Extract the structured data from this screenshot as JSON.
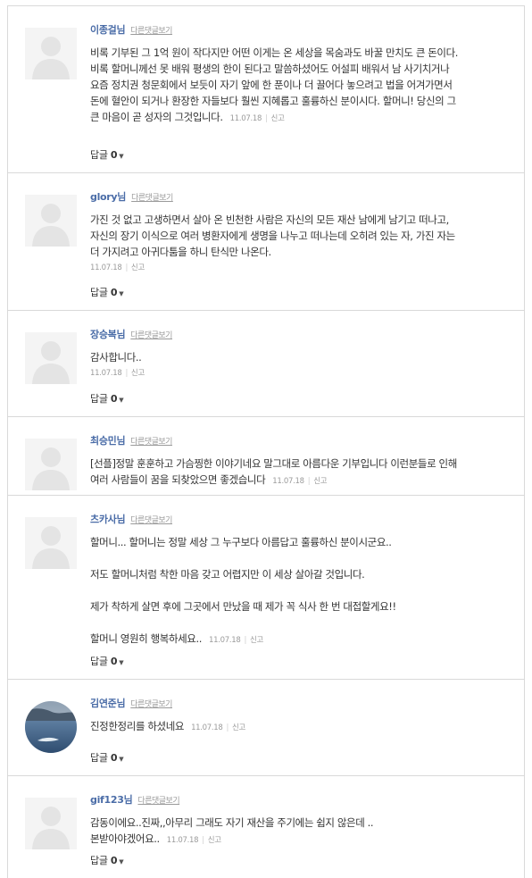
{
  "other_replies_label": "다른댓글보기",
  "report_label": "신고",
  "reply_label": "답글",
  "comments": [
    {
      "author": "이종걸님",
      "paragraphs": [
        "비록 기부된 그 1억 원이 작다지만 어떤 이게는 온 세상을 목숨과도 바꿀 만치도 큰 돈이다. 비록 할머니께선 못 배워 평생의 한이 된다고 말씀하셨어도 어설피 배워서 남 사기치거나 요즘 정치권 청문회에서 보듯이 자기 앞에 한 푼이나 더 끌어다 놓으려고 법을 어겨가면서 돈에 혈안이 되거나 환장한 자들보다 훨씬 지혜롭고 훌륭하신 분이시다. 할머니! 당신의 그 큰 마음이 곧 성자의 그것입니다."
      ],
      "date": "11.07.18",
      "replies": "0"
    },
    {
      "author": "glory님",
      "paragraphs": [
        "가진 것 없고 고생하면서 살아 온 빈천한 사람은 자신의 모든 재산 남에게 남기고 떠나고, 자신의 장기 이식으로 여러 병환자에게 생명을 나누고 떠나는데 오히려 있는 자, 가진 자는 더 가지려고 아귀다툼을 하니 탄식만 나온다."
      ],
      "date": "11.07.18",
      "replies": "0"
    },
    {
      "author": "장승복님",
      "paragraphs": [
        "감사합니다.."
      ],
      "date": "11.07.18",
      "replies": "0"
    },
    {
      "author": "최승민님",
      "paragraphs": [
        "[선플]정말 훈훈하고 가슴찡한 이야기네요 말그대로 아름다운 기부입니다 이런분들로 인해 여러 사람들이 꿈을 되찾았으면 좋겠습니다"
      ],
      "date": "11.07.18",
      "replies": null
    },
    {
      "author": "츠카사님",
      "paragraphs": [
        "할머니... 할머니는 정말 세상 그 누구보다 아름답고 훌륭하신 분이시군요..",
        "저도 할머니처럼 착한 마음 갖고 어렵지만 이 세상 살아갈 것입니다.",
        "제가 착하게 살면 후에 그곳에서 만났을 때 제가 꼭 식사 한 번 대접할게요!!",
        "할머니 영원히 행복하세요.."
      ],
      "date": "11.07.18",
      "replies": "0"
    },
    {
      "author": "김연준님",
      "paragraphs": [
        "진정한정리를 하셨네요"
      ],
      "date": "11.07.18",
      "replies": "0"
    },
    {
      "author": "gif123님",
      "paragraphs": [
        "감동이에요..진짜,,아무리 그래도 자기 재산을 주기에는 쉽지 않은데 ..본받아야겠어요.."
      ],
      "date": "11.07.18",
      "replies": "0"
    }
  ]
}
